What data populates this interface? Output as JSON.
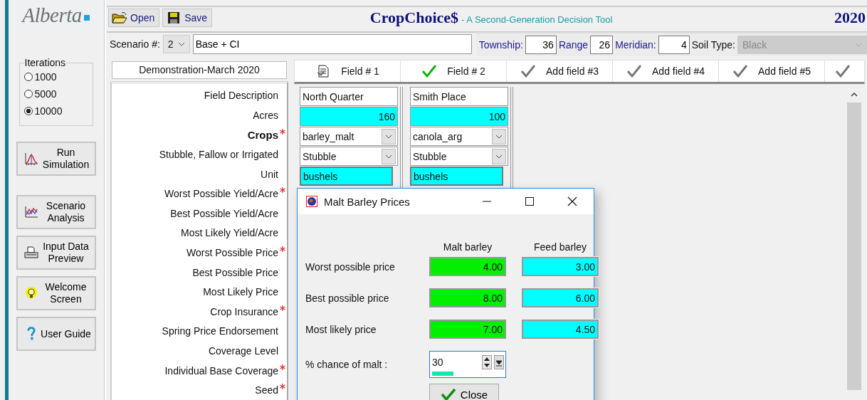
{
  "logo": {
    "text": "Alberta"
  },
  "toolbar": {
    "buttons": [
      {
        "kind": "open",
        "label": "Open"
      },
      {
        "kind": "save",
        "label": "Save"
      }
    ],
    "title": "CropChoice$",
    "subtitle": "- A Second-Generation Decision Tool",
    "year": "2020"
  },
  "location": {
    "scenario_label": "Scenario #:",
    "scenario_number": "2",
    "scenario_name": "Base + CI",
    "township_label": "Township:",
    "township": "36",
    "range_label": "Range",
    "range": "26",
    "meridian_label": "Meridian:",
    "meridian": "4",
    "soil_label": "Soil Type:",
    "soil": "Black",
    "soil_disabled": true
  },
  "iterations": {
    "title": "Iterations",
    "options": [
      {
        "label": "1000",
        "selected": false
      },
      {
        "label": "5000",
        "selected": false
      },
      {
        "label": "10000",
        "selected": true
      }
    ]
  },
  "side_buttons": [
    {
      "kind": "run",
      "label": "Run Simulation"
    },
    {
      "kind": "scenario",
      "label": "Scenario Analysis"
    },
    {
      "kind": "preview",
      "label": "Input Data Preview"
    },
    {
      "kind": "welcome",
      "label": "Welcome Screen"
    },
    {
      "kind": "guide",
      "label": "User Guide"
    }
  ],
  "data_set": "Demonstration-March 2020",
  "labels": [
    {
      "text": "Field Description",
      "required": false,
      "emphasis": false
    },
    {
      "text": "Acres",
      "required": false,
      "emphasis": false
    },
    {
      "text": "Crops",
      "required": true,
      "emphasis": true
    },
    {
      "text": "Stubble, Fallow or Irrigated",
      "required": false,
      "emphasis": false
    },
    {
      "text": "Unit",
      "required": false,
      "emphasis": false
    },
    {
      "text": "Worst Possible Yield/Acre",
      "required": true,
      "emphasis": false
    },
    {
      "text": "Best Possible Yield/Acre",
      "required": false,
      "emphasis": false
    },
    {
      "text": "Most Likely Yield/Acre",
      "required": false,
      "emphasis": false
    },
    {
      "text": "Worst Possible Price",
      "required": true,
      "emphasis": false
    },
    {
      "text": "Best Possible Price",
      "required": false,
      "emphasis": false
    },
    {
      "text": "Most Likely Price",
      "required": false,
      "emphasis": false
    },
    {
      "text": "Crop Insurance",
      "required": true,
      "emphasis": false
    },
    {
      "text": "Spring Price Endorsement",
      "required": false,
      "emphasis": false
    },
    {
      "text": "Coverage Level",
      "required": false,
      "emphasis": false
    },
    {
      "text": "Individual Base Coverage",
      "required": true,
      "emphasis": false
    },
    {
      "text": "Seed",
      "required": true,
      "emphasis": false
    }
  ],
  "field_tabs": [
    {
      "label": "Field # 1",
      "kind": "document"
    },
    {
      "label": "Field # 2",
      "kind": "valid"
    },
    {
      "label": "Add field #3",
      "kind": "empty"
    },
    {
      "label": "Add field #4",
      "kind": "empty"
    },
    {
      "label": "Add field #5",
      "kind": "empty"
    }
  ],
  "fields": [
    {
      "description": "North Quarter",
      "acres": "160",
      "crop": "barley_malt",
      "tillage": "Stubble",
      "unit": "bushels"
    },
    {
      "description": "Smith Place",
      "acres": "100",
      "crop": "canola_arg",
      "tillage": "Stubble",
      "unit": "bushels"
    }
  ],
  "dialog": {
    "title": "Malt Barley Prices",
    "columns": [
      "Malt barley",
      "Feed barley"
    ],
    "rows": [
      {
        "label": "Worst possible price",
        "malt": "4.00",
        "feed": "3.00"
      },
      {
        "label": "Best possible price",
        "malt": "8.00",
        "feed": "6.00"
      },
      {
        "label": "Most likely price",
        "malt": "7.00",
        "feed": "4.50"
      }
    ],
    "chance_label": "% chance of  malt :",
    "chance": "30",
    "level": 0.3,
    "close": "Close"
  }
}
